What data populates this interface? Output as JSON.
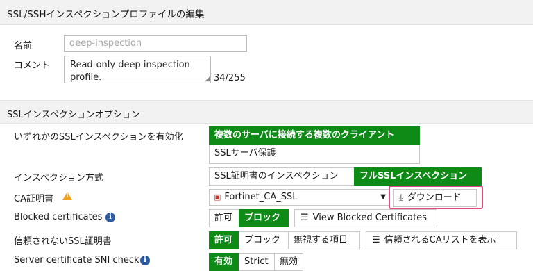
{
  "window": {
    "title": "SSL/SSHインスペクションプロファイルの編集"
  },
  "form": {
    "name_label": "名前",
    "name_value": "deep-inspection",
    "comment_label": "コメント",
    "comment_line1": "Read-only deep inspection",
    "comment_line2": "profile.",
    "comment_counter": "34/255"
  },
  "ssl_section": {
    "title": "SSLインスペクションオプション",
    "enable_label": "いずれかのSSLインスペクションを有効化",
    "enable_options": [
      "複数のサーバに接続する複数のクライアント",
      "SSLサーバ保護"
    ],
    "method_label": "インスペクション方式",
    "method_options": [
      "SSL証明書のインスペクション",
      "フルSSLインスペクション"
    ],
    "ca_label": "CA証明書",
    "ca_value": "Fortinet_CA_SSL",
    "download_label": "ダウンロード",
    "blocked_label": "Blocked certificates",
    "blocked_options": [
      "許可",
      "ブロック"
    ],
    "view_blocked_label": "View Blocked Certificates",
    "untrusted_label": "信頼されないSSL証明書",
    "untrusted_options": [
      "許可",
      "ブロック",
      "無視する項目"
    ],
    "view_ca_list_label": "信頼されるCAリストを表示",
    "sni_label": "Server certificate SNI check",
    "sni_options": [
      "有効",
      "Strict",
      "無効"
    ]
  },
  "icons": {
    "warning": "warning-icon",
    "info": "info-icon",
    "download": "download-icon",
    "list": "list-icon",
    "certificate": "certificate-icon"
  },
  "colors": {
    "accent": "#0e8a16",
    "highlight": "#e0487e",
    "info": "#2d5aa0",
    "warning": "#f0a21a"
  }
}
